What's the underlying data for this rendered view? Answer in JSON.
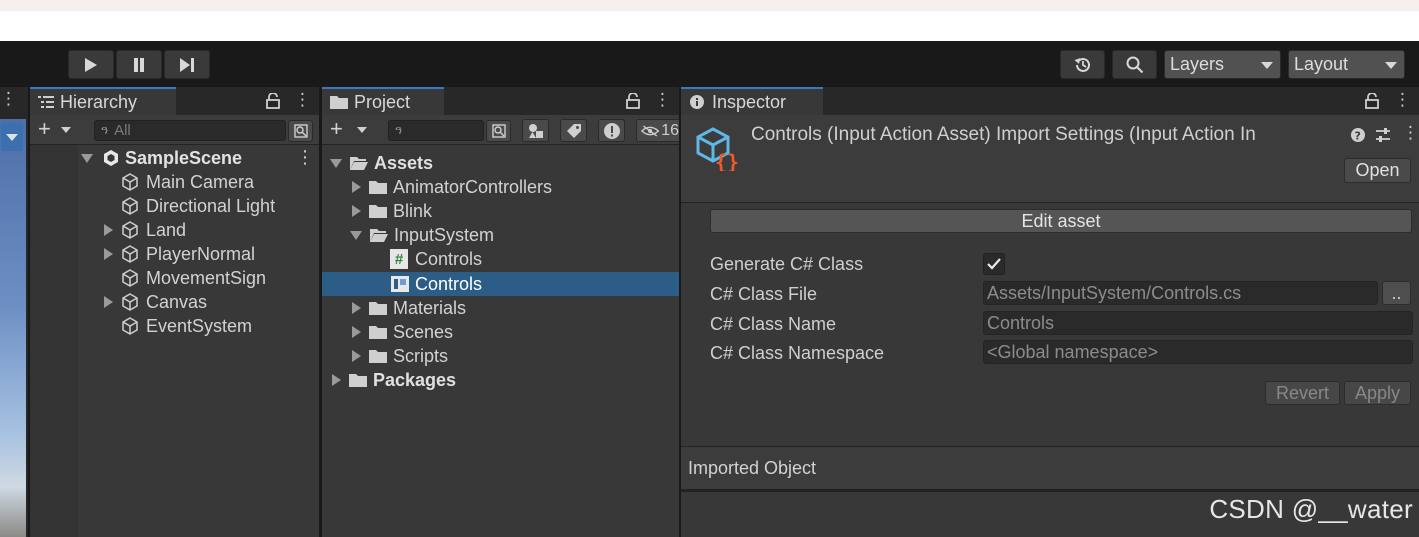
{
  "toolbar": {
    "layers_label": "Layers",
    "layout_label": "Layout"
  },
  "hierarchy": {
    "tab_label": "Hierarchy",
    "search_placeholder": "All",
    "scene_name": "SampleScene",
    "items": [
      {
        "label": "Main Camera",
        "expandable": false
      },
      {
        "label": "Directional Light",
        "expandable": false
      },
      {
        "label": "Land",
        "expandable": true
      },
      {
        "label": "PlayerNormal",
        "expandable": true
      },
      {
        "label": "MovementSign",
        "expandable": false
      },
      {
        "label": "Canvas",
        "expandable": true
      },
      {
        "label": "EventSystem",
        "expandable": false
      }
    ]
  },
  "project": {
    "tab_label": "Project",
    "hidden_count_label": "16",
    "tree": {
      "assets_label": "Assets",
      "animator_controllers": "AnimatorControllers",
      "blink": "Blink",
      "input_system": "InputSystem",
      "controls_script": "Controls",
      "controls_asset": "Controls",
      "materials": "Materials",
      "scenes": "Scenes",
      "scripts": "Scripts",
      "packages": "Packages"
    }
  },
  "inspector": {
    "tab_label": "Inspector",
    "header_title": "Controls (Input Action Asset) Import Settings (Input Action In",
    "open_button": "Open",
    "edit_asset_button": "Edit asset",
    "generate_label": "Generate C# Class",
    "generate_checked": true,
    "class_file_label": "C# Class File",
    "class_file_value": "Assets/InputSystem/Controls.cs",
    "browse_button": "..",
    "class_name_label": "C# Class Name",
    "class_name_value": "Controls",
    "namespace_label": "C# Class Namespace",
    "namespace_placeholder": "<Global namespace>",
    "revert_button": "Revert",
    "apply_button": "Apply",
    "imported_object_label": "Imported Object"
  },
  "watermark": "CSDN @__water",
  "colors": {
    "selection": "#2c5d87",
    "tab_accent": "#3a78c4",
    "panel_bg": "#383838",
    "toolbar_bg": "#191919"
  }
}
